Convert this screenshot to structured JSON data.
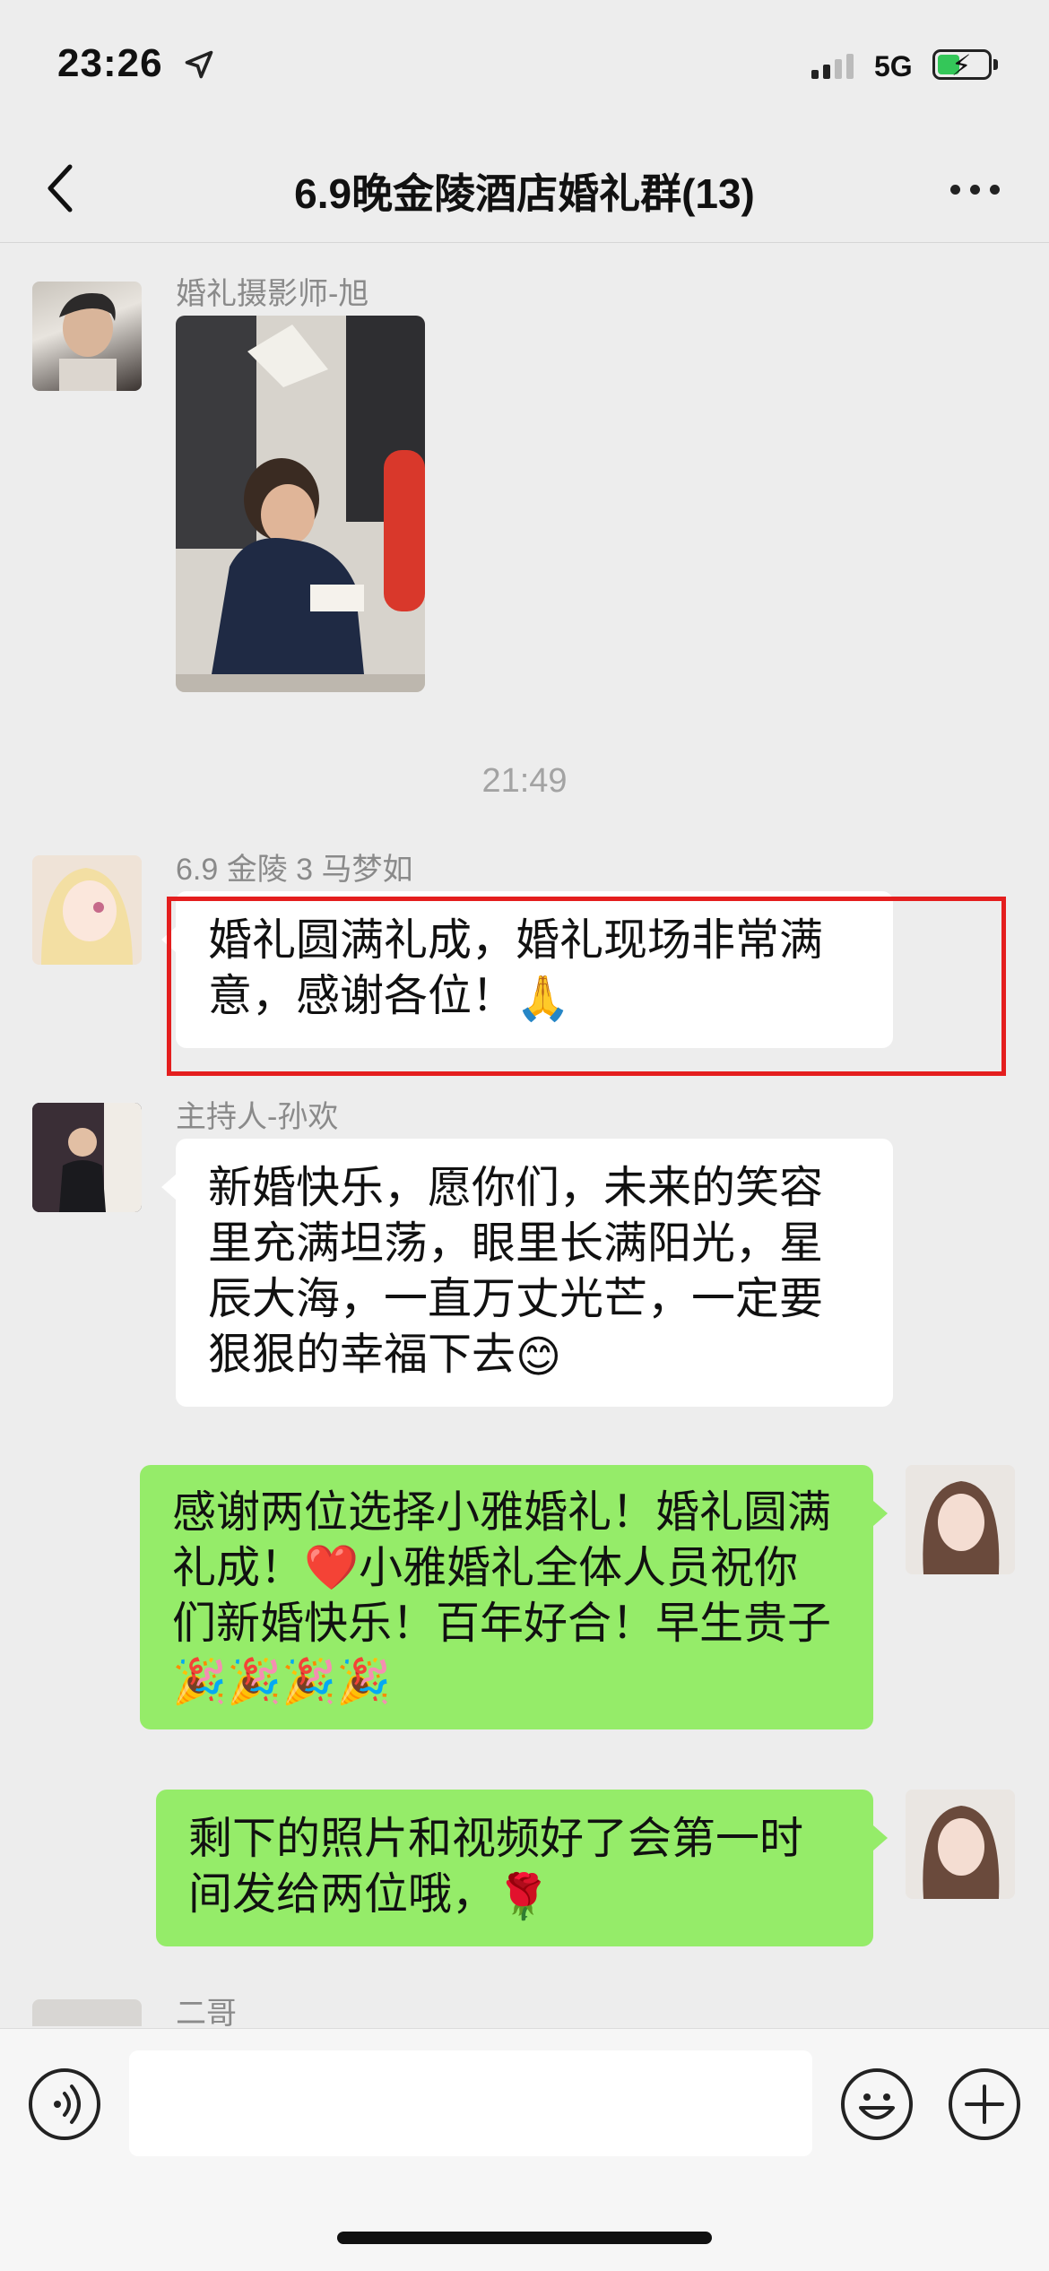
{
  "status_bar": {
    "time": "23:26",
    "network": "5G"
  },
  "nav": {
    "title": "6.9晚金陵酒店婚礼群(13)"
  },
  "messages": [
    {
      "sender": "婚礼摄影师-旭",
      "type": "image"
    },
    {
      "timestamp": "21:49"
    },
    {
      "sender": "6.9 金陵 3 马梦如",
      "text": "婚礼圆满礼成，婚礼现场非常满意，感谢各位！",
      "emoji": "🙏"
    },
    {
      "sender": "主持人-孙欢",
      "text": "新婚快乐，愿你们，未来的笑容里充满坦荡，眼里长满阳光，星辰大海，一直万丈光芒，一定要狠狠的幸福下去",
      "emoji": "😊"
    },
    {
      "self": true,
      "text_before": "感谢两位选择小雅婚礼！婚礼圆满礼成！",
      "heart": "❤️",
      "text_after": "小雅婚礼全体人员祝你们新婚快乐！百年好合！早生贵子",
      "emoji": "🎉🎉🎉🎉"
    },
    {
      "self": true,
      "text": "剩下的照片和视频好了会第一时间发给两位哦，",
      "emoji": "🌹"
    },
    {
      "sender": "二哥"
    }
  ],
  "colors": {
    "background": "#ededed",
    "self_bubble": "#95ec69",
    "other_bubble": "#ffffff",
    "highlight_box": "#e41e1e"
  },
  "icons": [
    "location-arrow-icon",
    "signal-icon",
    "battery-charging-icon",
    "back-chevron-icon",
    "more-dots-icon",
    "voice-icon",
    "emoji-icon",
    "plus-icon"
  ]
}
